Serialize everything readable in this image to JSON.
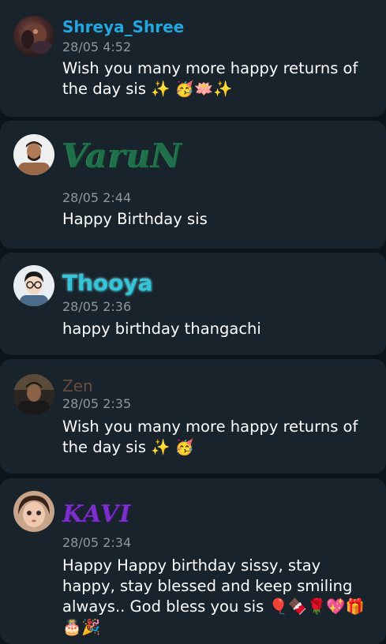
{
  "comments": [
    {
      "name": "Shreya_Shree",
      "time": "28/05 4:52",
      "message": "Wish you many more happy returns of the day sis ✨ 🥳🪷✨",
      "name_color": "#22a7e0",
      "avatar_icon": "user-avatar-photo"
    },
    {
      "name": "VaruN",
      "time": "28/05 2:44",
      "message": "Happy Birthday sis",
      "name_color": "#1f6f4a",
      "avatar_icon": "user-avatar-photo"
    },
    {
      "name": "Thooya",
      "time": "28/05 2:36",
      "message": "happy birthday thangachi",
      "name_color": "#36c4d6",
      "avatar_icon": "user-avatar-cartoon"
    },
    {
      "name": "Zen",
      "time": "28/05 2:35",
      "message": "Wish you many more happy returns of the day sis ✨ 🥳",
      "name_color": "#6b4d3d",
      "avatar_icon": "user-avatar-photo"
    },
    {
      "name": "KAVI",
      "time": "28/05 2:34",
      "message": "Happy Happy birthday sissy, stay happy, stay blessed and keep smiling always.. God bless you sis 🎈🍫🌹💖🎁🎂🎉",
      "name_color": "#7a2fc9",
      "avatar_icon": "user-avatar-photo"
    }
  ]
}
